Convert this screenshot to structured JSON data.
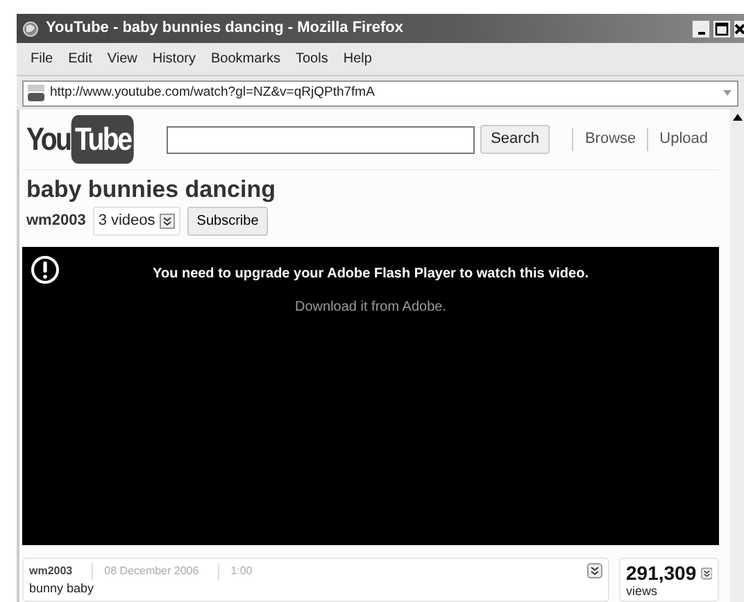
{
  "window": {
    "title": "YouTube - baby bunnies dancing - Mozilla Firefox"
  },
  "menu": [
    "File",
    "Edit",
    "View",
    "History",
    "Bookmarks",
    "Tools",
    "Help"
  ],
  "address": {
    "url": "http://www.youtube.com/watch?gl=NZ&v=qRjQPth7fmA"
  },
  "header": {
    "logo_left": "You",
    "logo_right": "Tube",
    "search_button": "Search",
    "links": [
      "Browse",
      "Upload"
    ]
  },
  "video": {
    "title": "baby bunnies dancing",
    "channel": "wm2003",
    "videos": "3 videos",
    "subscribe": "Subscribe",
    "message": "You need to upgrade your Adobe Flash Player to watch this video.",
    "download": "Download it from Adobe."
  },
  "info": {
    "author": "wm2003",
    "date": "08 December 2006",
    "duration": "1:00",
    "description": "bunny baby",
    "views": "291,309",
    "views_label": "views"
  }
}
